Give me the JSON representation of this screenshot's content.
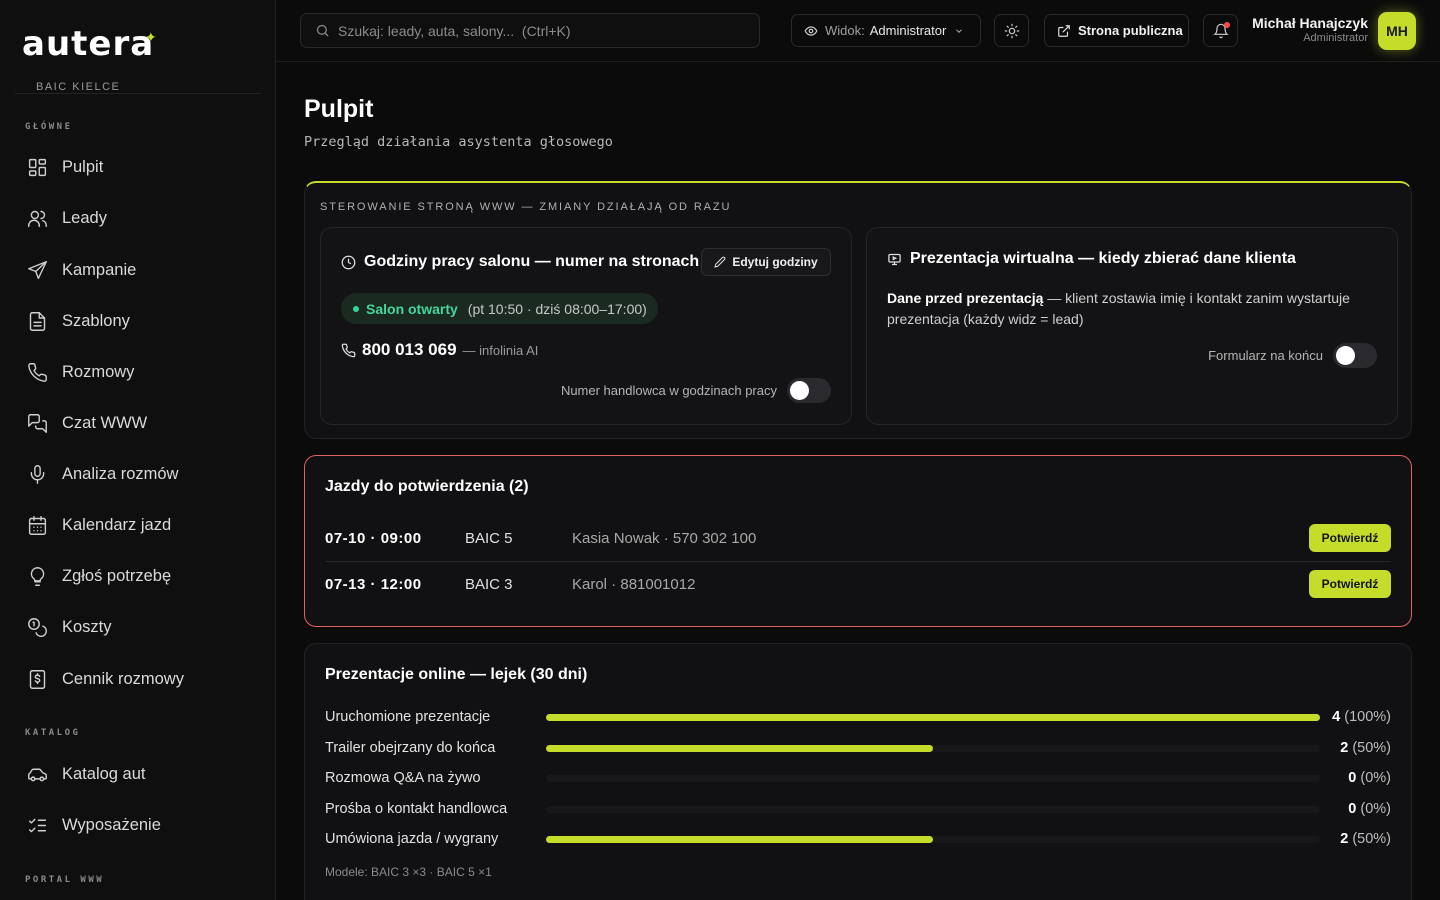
{
  "brand": {
    "logo": "autera",
    "dealer": "BAIC KIELCE",
    "accent": "#c5dd2a"
  },
  "sidebar": {
    "sections": [
      {
        "label": "GŁÓWNE"
      },
      {
        "label": "KATALOG"
      },
      {
        "label": "PORTAL WWW"
      }
    ],
    "items": [
      {
        "label": "Pulpit",
        "icon": "dashboard-icon"
      },
      {
        "label": "Leady",
        "icon": "users-icon"
      },
      {
        "label": "Kampanie",
        "icon": "send-icon"
      },
      {
        "label": "Szablony",
        "icon": "file-icon"
      },
      {
        "label": "Rozmowy",
        "icon": "phone-icon"
      },
      {
        "label": "Czat WWW",
        "icon": "chat-icon"
      },
      {
        "label": "Analiza rozmów",
        "icon": "microphone-icon"
      },
      {
        "label": "Kalendarz jazd",
        "icon": "calendar-icon"
      },
      {
        "label": "Zgłoś potrzebę",
        "icon": "lightbulb-icon"
      },
      {
        "label": "Koszty",
        "icon": "coins-icon"
      },
      {
        "label": "Cennik rozmowy",
        "icon": "pricing-icon"
      },
      {
        "label": "Katalog aut",
        "icon": "car-icon"
      },
      {
        "label": "Wyposażenie",
        "icon": "checklist-icon"
      }
    ]
  },
  "topbar": {
    "search_placeholder": "Szukaj: leady, auta, salony...  (Ctrl+K)",
    "view_label": "Widok:",
    "view_value": "Administrator",
    "public_button": "Strona publiczna",
    "user_name": "Michał Hanajczyk",
    "user_role": "Administrator",
    "user_initials": "MH"
  },
  "page": {
    "title": "Pulpit",
    "subtitle": "Przegląd działania asystenta głosowego"
  },
  "web_control": {
    "label": "STEROWANIE STRONĄ WWW — ZMIANY DZIAŁAJĄ OD RAZU",
    "hours": {
      "title": "Godziny pracy salonu — numer na stronach",
      "edit_button": "Edytuj godziny",
      "status": "Salon otwarty",
      "schedule": "(pt 10:50 · dziś 08:00–17:00)",
      "phone": "800 013 069",
      "phone_desc": "— infolinia AI",
      "toggle_label": "Numer handlowca w godzinach pracy",
      "toggle_on": false
    },
    "presentation": {
      "title": "Prezentacja wirtualna — kiedy zbierać dane klienta",
      "desc_bold": "Dane przed prezentacją",
      "desc_rest": " — klient zostawia imię i kontakt zanim wystartuje prezentacja (każdy widz = lead)",
      "toggle_label": "Formularz na końcu",
      "toggle_on": false
    }
  },
  "drives": {
    "title": "Jazdy do potwierdzenia (2)",
    "confirm_label": "Potwierdź",
    "rows": [
      {
        "datetime": "07-10 · 09:00",
        "model": "BAIC 5",
        "contact": "Kasia Nowak · 570 302 100"
      },
      {
        "datetime": "07-13 · 12:00",
        "model": "BAIC 3",
        "contact": "Karol · 881001012"
      }
    ]
  },
  "funnel": {
    "title": "Prezentacje online — lejek (30 dni)",
    "rows": [
      {
        "label": "Uruchomione prezentacje",
        "count": "4",
        "pct": "(100%)",
        "fraction": 1.0
      },
      {
        "label": "Trailer obejrzany do końca",
        "count": "2",
        "pct": "(50%)",
        "fraction": 0.5
      },
      {
        "label": "Rozmowa Q&A na żywo",
        "count": "0",
        "pct": "(0%)",
        "fraction": 0
      },
      {
        "label": "Prośba o kontakt handlowca",
        "count": "0",
        "pct": "(0%)",
        "fraction": 0
      },
      {
        "label": "Umówiona jazda / wygrany",
        "count": "2",
        "pct": "(50%)",
        "fraction": 0.5
      }
    ],
    "models": "Modele: BAIC 3 ×3 · BAIC 5 ×1"
  }
}
